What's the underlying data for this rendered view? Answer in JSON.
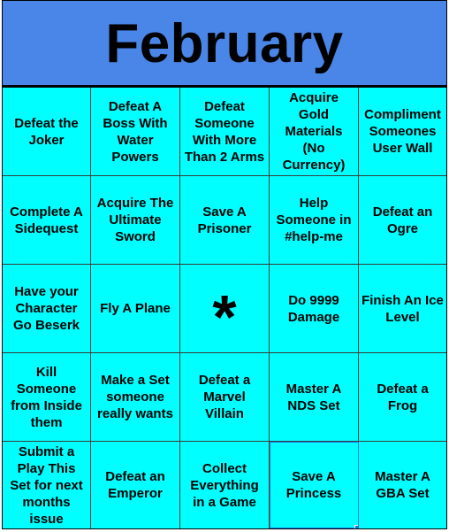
{
  "title": "February",
  "colors": {
    "header_bg": "#4a86e8",
    "cell_bg": "#00ffff",
    "text": "#000000",
    "selection": "#1a73e8"
  },
  "rows": [
    [
      "Defeat the Joker",
      "Defeat A Boss With Water Powers",
      "Defeat Someone With More Than 2 Arms",
      "Acquire Gold Materials (No Currency)",
      "Compliment Someones User Wall"
    ],
    [
      "Complete A Sidequest",
      "Acquire The Ultimate Sword",
      "Save A Prisoner",
      "Help Someone in #help-me",
      "Defeat an Ogre"
    ],
    [
      "Have your Character Go Beserk",
      "Fly A Plane",
      "*",
      "Do 9999 Damage",
      "Finish An Ice Level"
    ],
    [
      "Kill Someone from Inside them",
      "Make a Set someone really wants",
      "Defeat a Marvel Villain",
      "Master A NDS Set",
      "Defeat a Frog"
    ],
    [
      "Submit a Play This Set for next months issue",
      "Defeat an Emperor",
      "Collect Everything in a Game",
      "Save A Princess",
      "Master A GBA Set"
    ]
  ]
}
